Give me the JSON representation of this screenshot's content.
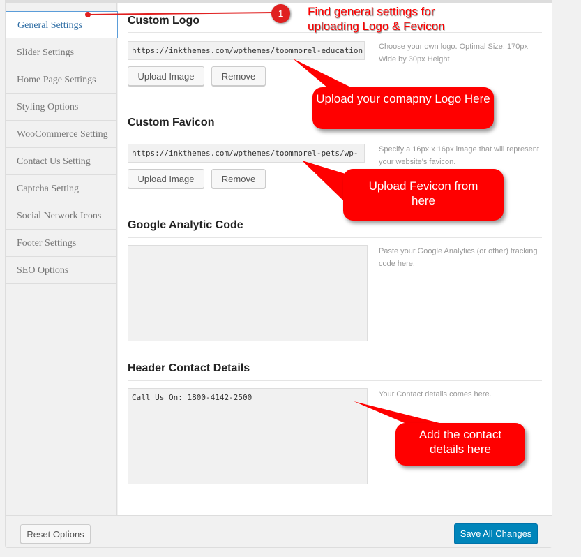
{
  "sidebar": {
    "items": [
      {
        "label": "General Settings",
        "active": true
      },
      {
        "label": "Slider Settings"
      },
      {
        "label": "Home Page Settings"
      },
      {
        "label": "Styling Options"
      },
      {
        "label": "WooCommerce Setting"
      },
      {
        "label": "Contact Us Setting"
      },
      {
        "label": "Captcha Setting"
      },
      {
        "label": "Social Network Icons"
      },
      {
        "label": "Footer Settings"
      },
      {
        "label": "SEO Options"
      }
    ]
  },
  "sections": {
    "logo": {
      "title": "Custom Logo",
      "value": "https://inkthemes.com/wpthemes/toommorel-education",
      "upload": "Upload Image",
      "remove": "Remove",
      "desc": "Choose your own logo. Optimal Size: 170px Wide by 30px Height"
    },
    "favicon": {
      "title": "Custom Favicon",
      "value": "https://inkthemes.com/wpthemes/toommorel-pets/wp-",
      "upload": "Upload Image",
      "remove": "Remove",
      "desc": "Specify a 16px x 16px image that will represent your website's favicon."
    },
    "analytics": {
      "title": "Google Analytic Code",
      "value": "",
      "desc": "Paste your Google Analytics (or other) tracking code here."
    },
    "contact": {
      "title": "Header Contact Details",
      "value": "Call Us On: 1800-4142-2500",
      "desc": "Your Contact details comes here."
    }
  },
  "footer": {
    "reset": "Reset Options",
    "save": "Save All Changes"
  },
  "annotations": {
    "step": "1",
    "note": "Find general settings for uploading Logo & Fevicon",
    "logo": "Upload your comapny Logo Here",
    "favicon": "Upload Fevicon from here",
    "contact": "Add the contact details here"
  },
  "colors": {
    "primary": "#0085ba",
    "callout": "#ff0000",
    "active_border": "#5b9dd9"
  }
}
